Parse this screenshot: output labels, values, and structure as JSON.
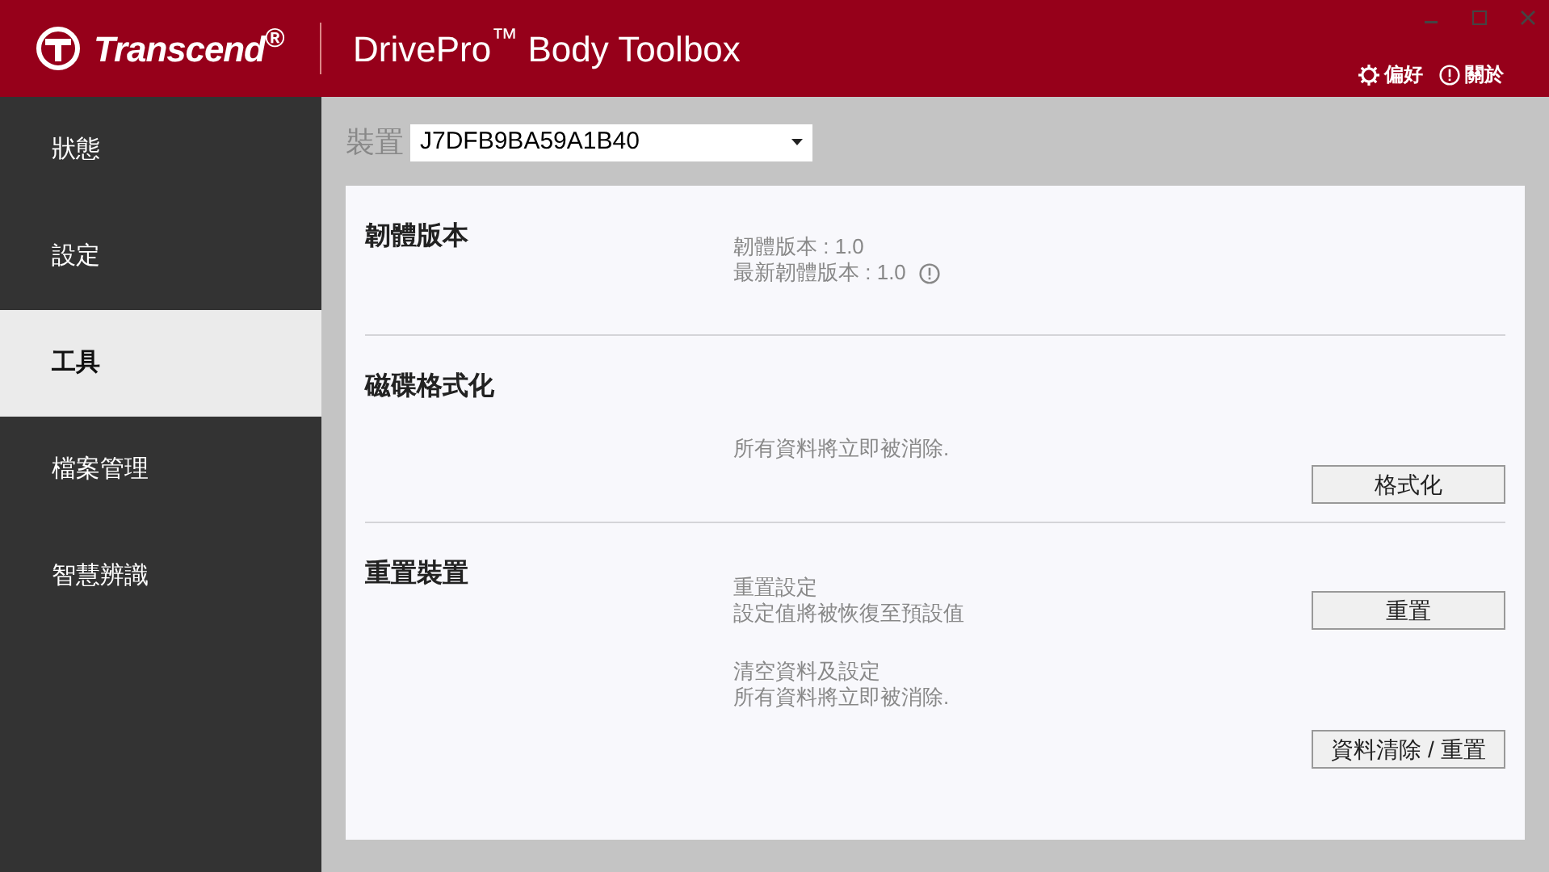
{
  "header": {
    "brand": "Transcend$^{®}$",
    "title": "DrivePro$^{™}$ Body Toolbox",
    "links": [
      {
        "kind": "gear",
        "label": "偏好"
      },
      {
        "kind": "info",
        "label": "關於"
      }
    ]
  },
  "sidebar": {
    "items": [
      {
        "label": "狀態",
        "selected": false
      },
      {
        "label": "設定",
        "selected": false
      },
      {
        "label": "工具",
        "selected": true
      },
      {
        "label": "檔案管理",
        "selected": false
      },
      {
        "label": "智慧辨識",
        "selected": false
      }
    ]
  },
  "device": {
    "label": "裝置",
    "value": "J7DFB9BA59A1B40"
  },
  "sections": [
    {
      "heading": "韌體版本",
      "blocks": [
        {
          "lines": [
            {
              "text": "韌體版本 : 1.0",
              "info": false
            },
            {
              "text": "最新韌體版本 : 1.0",
              "info": true
            }
          ]
        }
      ]
    },
    {
      "heading": "磁碟格式化",
      "blocks": [
        {
          "lines": [
            {
              "text": "所有資料將立即被消除.",
              "info": false
            }
          ],
          "button": "格式化"
        }
      ]
    },
    {
      "heading": "重置裝置",
      "blocks": [
        {
          "lines": [
            {
              "text": "重置設定",
              "info": false
            },
            {
              "text": "設定值將被恢復至預設值",
              "info": false
            }
          ],
          "button": "重置"
        },
        {
          "lines": [
            {
              "text": "清空資料及設定",
              "info": false
            },
            {
              "text": "所有資料將立即被消除.",
              "info": false
            }
          ],
          "button": "資料清除 / 重置"
        }
      ]
    }
  ]
}
